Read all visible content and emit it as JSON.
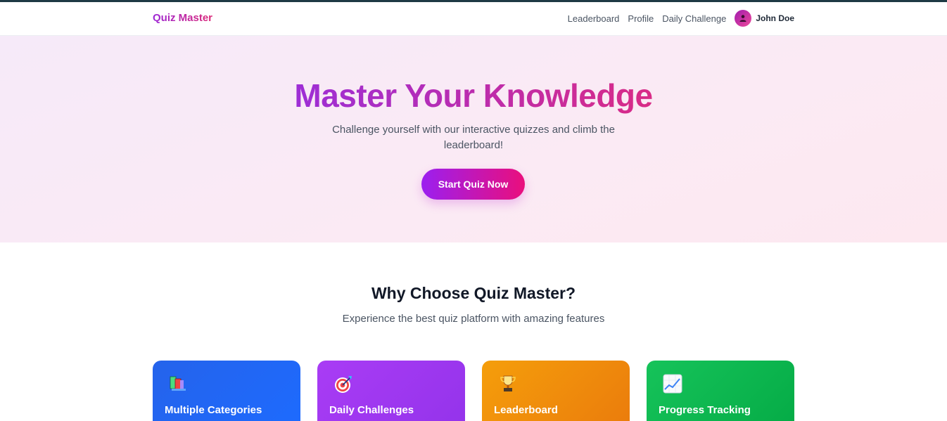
{
  "nav": {
    "brand": "Quiz Master",
    "links": [
      "Leaderboard",
      "Profile",
      "Daily Challenge"
    ],
    "user_name": "John Doe",
    "avatar_icon": "user-icon"
  },
  "hero": {
    "title": "Master Your Knowledge",
    "subtitle": "Challenge yourself with our interactive quizzes and climb the leaderboard!",
    "cta_label": "Start Quiz Now"
  },
  "features": {
    "title": "Why Choose Quiz Master?",
    "subtitle": "Experience the best quiz platform with amazing features",
    "cards": [
      {
        "title": "Multiple Categories",
        "icon": "books-icon",
        "color": "#2563eb"
      },
      {
        "title": "Daily Challenges",
        "icon": "target-icon",
        "color": "#a93cf5"
      },
      {
        "title": "Leaderboard",
        "icon": "trophy-icon",
        "color": "#f59e0b"
      },
      {
        "title": "Progress Tracking",
        "icon": "chart-icon",
        "color": "#16c35a"
      }
    ]
  },
  "colors": {
    "brand_gradient_start": "#9d27d6",
    "brand_gradient_end": "#db2777",
    "hero_bg": "#f6eaf9"
  }
}
